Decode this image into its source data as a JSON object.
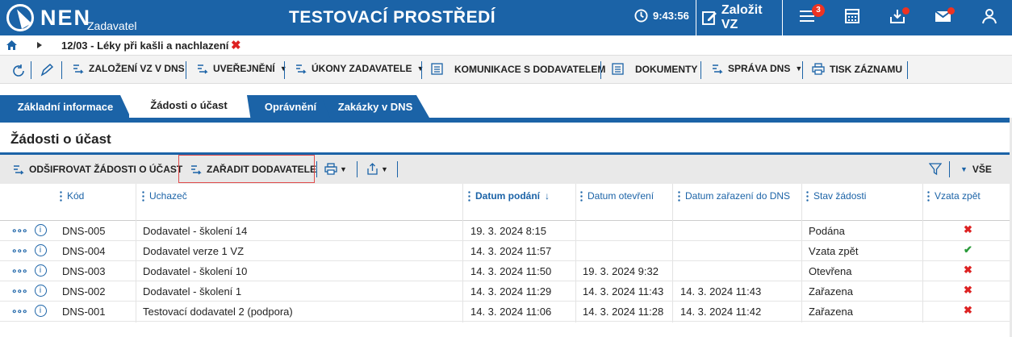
{
  "header": {
    "logo_text": "NEN",
    "logo_sub": "Zadavatel",
    "env_title": "TESTOVACÍ PROSTŘEDÍ",
    "clock": "9:43:56",
    "create_label": "Založit VZ",
    "menu_badge": "3"
  },
  "breadcrumb": {
    "title": "12/03 - Léky při kašli a nachlazení"
  },
  "toolbar": {
    "items": [
      {
        "label": "ZALOŽENÍ VZ V DNS"
      },
      {
        "label": "UVEŘEJNĚNÍ"
      },
      {
        "label": "ÚKONY ZADAVATELE"
      },
      {
        "label": "KOMUNIKACE S DODAVATELEM"
      },
      {
        "label": "DOKUMENTY"
      },
      {
        "label": "SPRÁVA DNS"
      },
      {
        "label": "TISK ZÁZNAMU"
      }
    ]
  },
  "tabs": [
    {
      "label": "Základní informace"
    },
    {
      "label": "Žádosti o účast"
    },
    {
      "label": "Oprávnění"
    },
    {
      "label": "Zakázky v DNS"
    }
  ],
  "section_title": "Žádosti o účast",
  "actions": {
    "decrypt": "ODŠIFROVAT ŽÁDOSTI O ÚČAST",
    "add_supplier": "ZAŘADIT DODAVATELE",
    "filter_all": "VŠE"
  },
  "table": {
    "columns": [
      "Kód",
      "Uchazeč",
      "Datum podání",
      "Datum otevření",
      "Datum zařazení do DNS",
      "Stav žádosti",
      "Vzata zpět"
    ],
    "rows": [
      {
        "code": "DNS-005",
        "name": "Dodavatel - školení 14",
        "submitted": "19. 3. 2024 8:15",
        "opened": "",
        "included": "",
        "state": "Podána",
        "withdrawn": false
      },
      {
        "code": "DNS-004",
        "name": "Dodavatel verze 1 VZ",
        "submitted": "14. 3. 2024 11:57",
        "opened": "",
        "included": "",
        "state": "Vzata zpět",
        "withdrawn": true
      },
      {
        "code": "DNS-003",
        "name": "Dodavatel - školení 10",
        "submitted": "14. 3. 2024 11:50",
        "opened": "19. 3. 2024 9:32",
        "included": "",
        "state": "Otevřena",
        "withdrawn": false
      },
      {
        "code": "DNS-002",
        "name": "Dodavatel - školení 1",
        "submitted": "14. 3. 2024 11:29",
        "opened": "14. 3. 2024 11:43",
        "included": "14. 3. 2024 11:43",
        "state": "Zařazena",
        "withdrawn": false
      },
      {
        "code": "DNS-001",
        "name": "Testovací dodavatel 2 (podpora)",
        "submitted": "14. 3. 2024 11:06",
        "opened": "14. 3. 2024 11:28",
        "included": "14. 3. 2024 11:42",
        "state": "Zařazena",
        "withdrawn": false
      }
    ]
  },
  "colors": {
    "brand": "#1b63a7",
    "danger": "#d22",
    "success": "#2a9a3a"
  }
}
